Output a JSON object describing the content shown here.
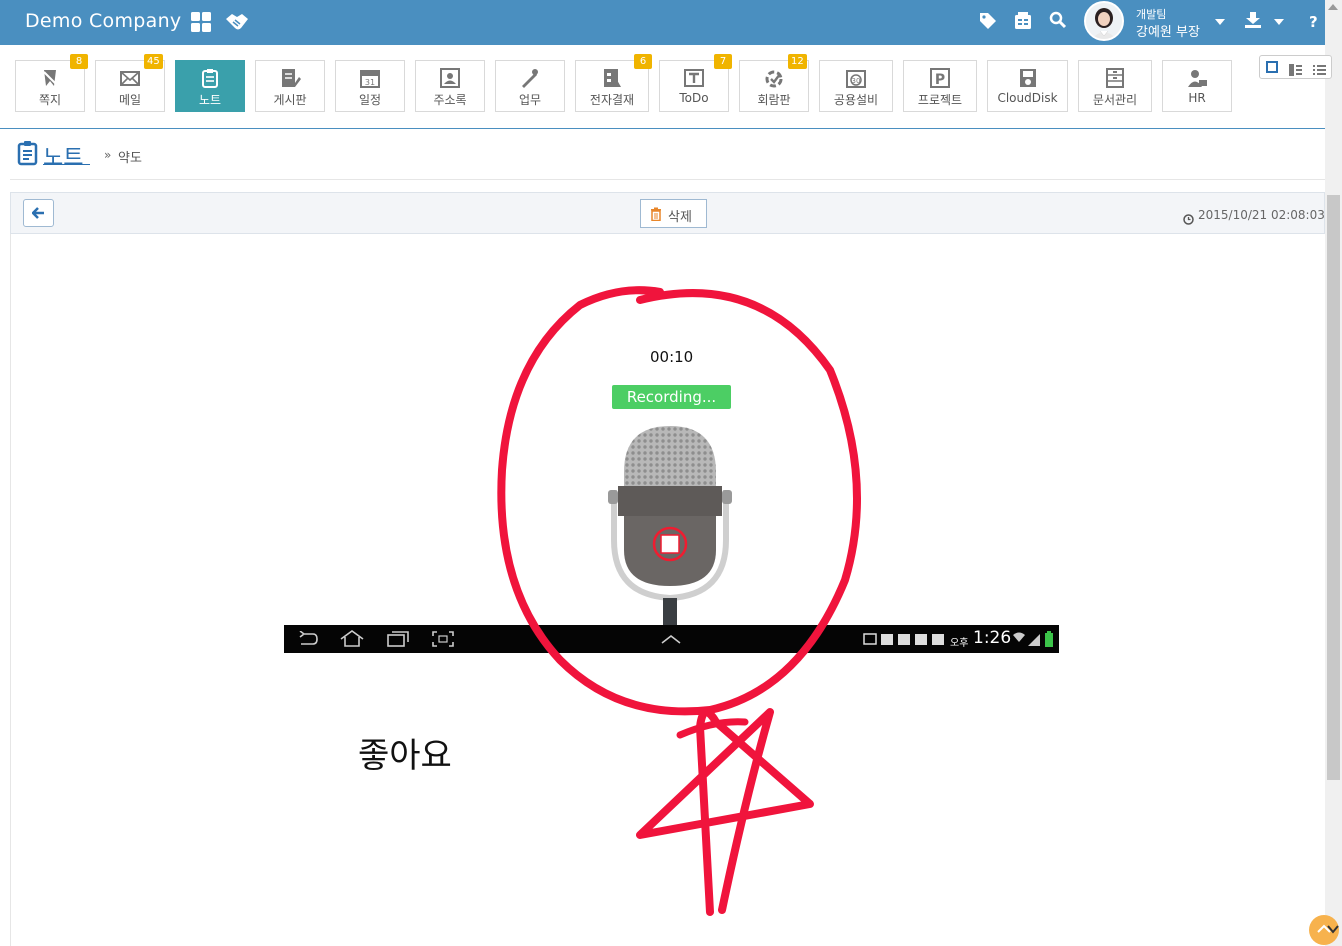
{
  "topbar": {
    "brand": "Demo Company",
    "user_team": "개발팀",
    "user_name": "강예원 부장",
    "help": "?"
  },
  "apps": [
    {
      "label": "쪽지",
      "badge": "8",
      "active": false
    },
    {
      "label": "메일",
      "badge": "45",
      "active": false
    },
    {
      "label": "노트",
      "badge": "",
      "active": true
    },
    {
      "label": "게시판",
      "badge": "",
      "active": false
    },
    {
      "label": "일정",
      "badge": "",
      "active": false
    },
    {
      "label": "주소록",
      "badge": "",
      "active": false
    },
    {
      "label": "업무",
      "badge": "",
      "active": false
    },
    {
      "label": "전자결재",
      "badge": "6",
      "active": false
    },
    {
      "label": "ToDo",
      "badge": "7",
      "active": false
    },
    {
      "label": "회람판",
      "badge": "12",
      "active": false
    },
    {
      "label": "공용설비",
      "badge": "",
      "active": false
    },
    {
      "label": "프로젝트",
      "badge": "",
      "active": false
    },
    {
      "label": "CloudDisk",
      "badge": "",
      "active": false
    },
    {
      "label": "문서관리",
      "badge": "",
      "active": false
    },
    {
      "label": "HR",
      "badge": "",
      "active": false
    }
  ],
  "breadcrumb": {
    "title": "노트",
    "separator": "»",
    "current": "약도"
  },
  "note": {
    "delete_label": "삭제",
    "timestamp": "2015/10/21 02:08:03",
    "recording_time": "00:10",
    "recording_status": "Recording...",
    "android_time": "1:26",
    "android_ampm": "오후",
    "text": "좋아요"
  },
  "colors": {
    "header": "#4a8fc0",
    "active_app": "#3aa0ab",
    "badge": "#f0b400",
    "recording": "#4cce64",
    "annotation": "#f0143c"
  },
  "icons": {
    "topbar": [
      "grid-icon",
      "handshake-icon",
      "tag-icon",
      "fax-icon",
      "search-icon",
      "download-icon",
      "help-icon"
    ],
    "apps": [
      "memo-icon",
      "mail-icon",
      "note-icon",
      "board-icon",
      "calendar-icon",
      "contacts-icon",
      "task-icon",
      "approval-icon",
      "todo-icon",
      "circular-icon",
      "facility-icon",
      "project-icon",
      "cloud-icon",
      "docs-icon",
      "hr-icon"
    ]
  }
}
